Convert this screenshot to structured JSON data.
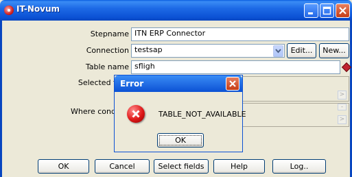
{
  "window": {
    "title": "IT-Novum"
  },
  "form": {
    "stepname_label": "Stepname",
    "stepname_value": "ITN ERP Connector",
    "connection_label": "Connection",
    "connection_value": "testsap",
    "edit_label": "Edit...",
    "new_label": "New...",
    "tablename_label": "Table name",
    "tablename_value": "sfligh",
    "selected_fields_label": "Selected fi",
    "where_condition_label": "Where condi"
  },
  "buttons": {
    "ok": "OK",
    "cancel": "Cancel",
    "select_fields": "Select fields",
    "help": "Help",
    "log": "Log.."
  },
  "dialog": {
    "title": "Error",
    "message": "TABLE_NOT_AVAILABLE",
    "ok": "OK"
  }
}
